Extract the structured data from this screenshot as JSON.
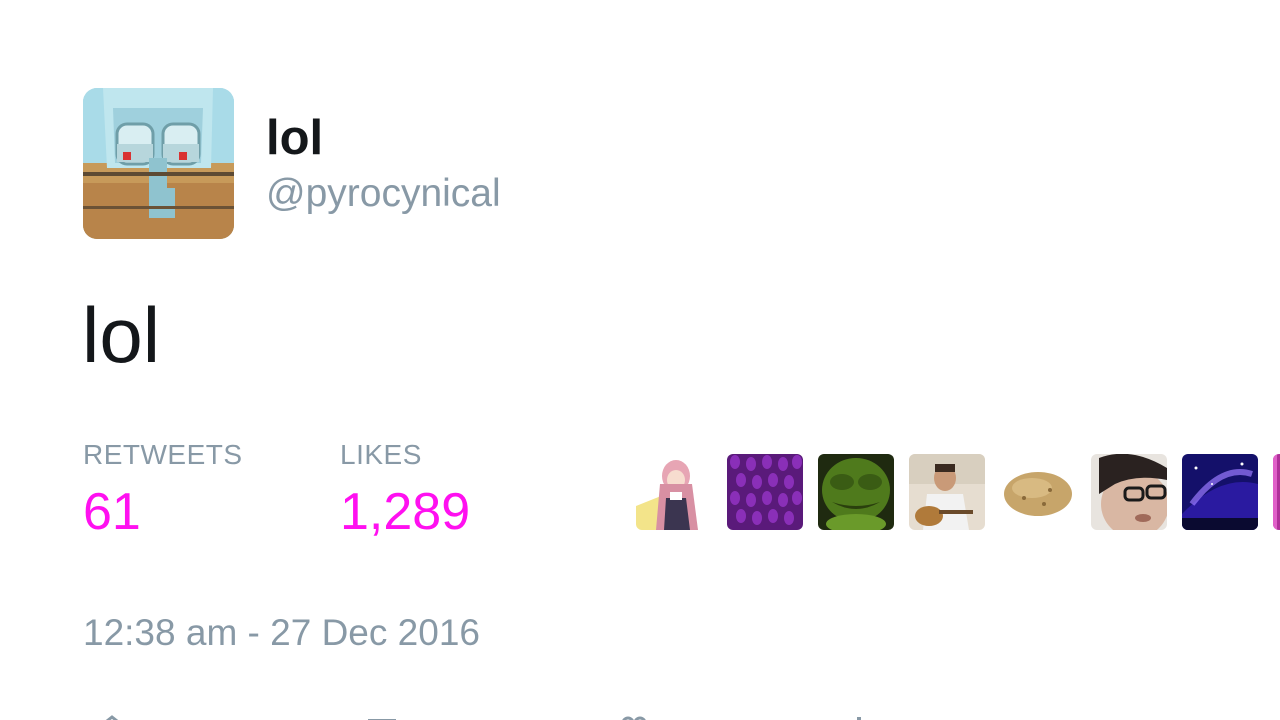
{
  "tweet": {
    "display_name": "lol",
    "handle": "@pyrocynical",
    "text": "lol",
    "timestamp": "12:38 am - 27 Dec 2016"
  },
  "stats": {
    "retweets_label": "RETWEETS",
    "retweets_value": "61",
    "likes_label": "LIKES",
    "likes_value": "1,289"
  },
  "colors": {
    "stat_value": "#ff10f0",
    "secondary_text": "#8899a6",
    "primary_text": "#14171a"
  },
  "likers": [
    {
      "icon": "anime-girl-avatar"
    },
    {
      "icon": "purple-pattern-avatar"
    },
    {
      "icon": "green-frog-avatar"
    },
    {
      "icon": "person-guitar-avatar"
    },
    {
      "icon": "potato-avatar"
    },
    {
      "icon": "face-closeup-avatar"
    },
    {
      "icon": "galaxy-avatar"
    },
    {
      "icon": "pink-avatar"
    }
  ],
  "actions": [
    {
      "icon": "reply-icon"
    },
    {
      "icon": "retweet-icon"
    },
    {
      "icon": "like-icon"
    },
    {
      "icon": "more-icon"
    }
  ]
}
